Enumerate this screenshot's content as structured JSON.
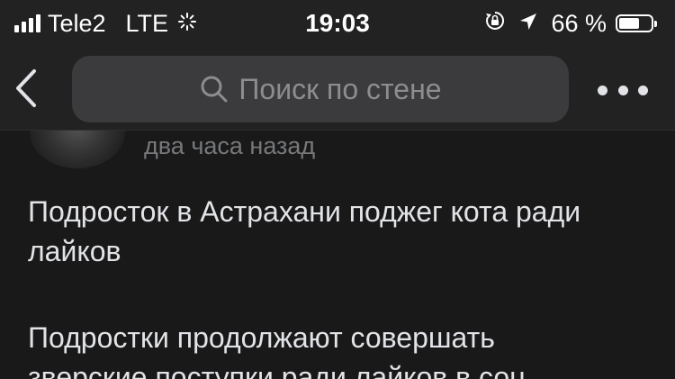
{
  "status_bar": {
    "carrier": "Tele2",
    "network": "LTE",
    "time": "19:03",
    "battery_text": "66 %",
    "battery_level": 0.66,
    "icons": [
      "signal-icon",
      "activity-spinner-icon",
      "orientation-lock-icon",
      "location-arrow-icon",
      "battery-icon"
    ]
  },
  "nav": {
    "back_icon": "chevron-left-icon",
    "search_placeholder": "Поиск по стене",
    "more_icon": "more-dots-icon"
  },
  "post": {
    "time": "два часа назад",
    "title": "Подросток в Астрахани поджег кота ради лайков",
    "body": "Подростки продолжают совершать\nзверские поступки ради лайков в соц"
  },
  "colors": {
    "background": "#19191a",
    "bar": "#222223",
    "search_field": "#3b3b3d",
    "secondary_text": "#76787a"
  }
}
